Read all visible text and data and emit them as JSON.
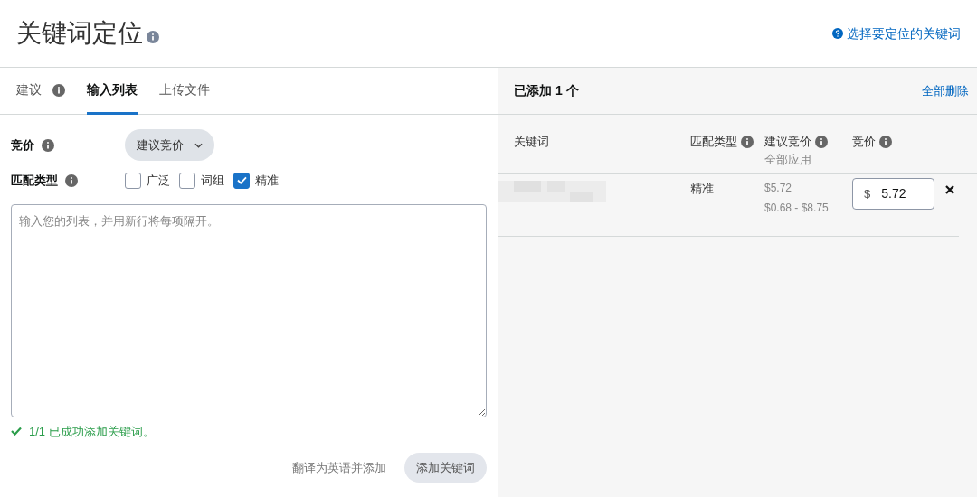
{
  "header": {
    "title": "关键词定位",
    "help_link": "选择要定位的关键词"
  },
  "tabs": [
    {
      "label": "建议",
      "info": true,
      "selected": false
    },
    {
      "label": "输入列表",
      "info": false,
      "selected": true
    },
    {
      "label": "上传文件",
      "info": false,
      "selected": false
    }
  ],
  "bid": {
    "label": "竞价",
    "dropdown": "建议竞价"
  },
  "match_type": {
    "label": "匹配类型",
    "options": [
      {
        "label": "广泛",
        "checked": false
      },
      {
        "label": "词组",
        "checked": false
      },
      {
        "label": "精准",
        "checked": true
      }
    ]
  },
  "list_input": {
    "placeholder": "输入您的列表，并用新行将每项隔开。"
  },
  "success_message": "1/1 已成功添加关键词。",
  "actions": {
    "translate": "翻译为英语并添加",
    "add": "添加关键词"
  },
  "added": {
    "title": "已添加 1 个",
    "remove_all": "全部删除",
    "columns": [
      {
        "label": "关键词",
        "info": false
      },
      {
        "label": "匹配类型",
        "info": true
      },
      {
        "label": "建议竞价",
        "info": true,
        "sub": "全部应用"
      },
      {
        "label": "竞价",
        "info": true
      }
    ],
    "rows": [
      {
        "match": "精准",
        "suggested": "$5.72",
        "range": "$0.68 - $8.75",
        "currency": "$",
        "bid": "5.72"
      }
    ]
  }
}
